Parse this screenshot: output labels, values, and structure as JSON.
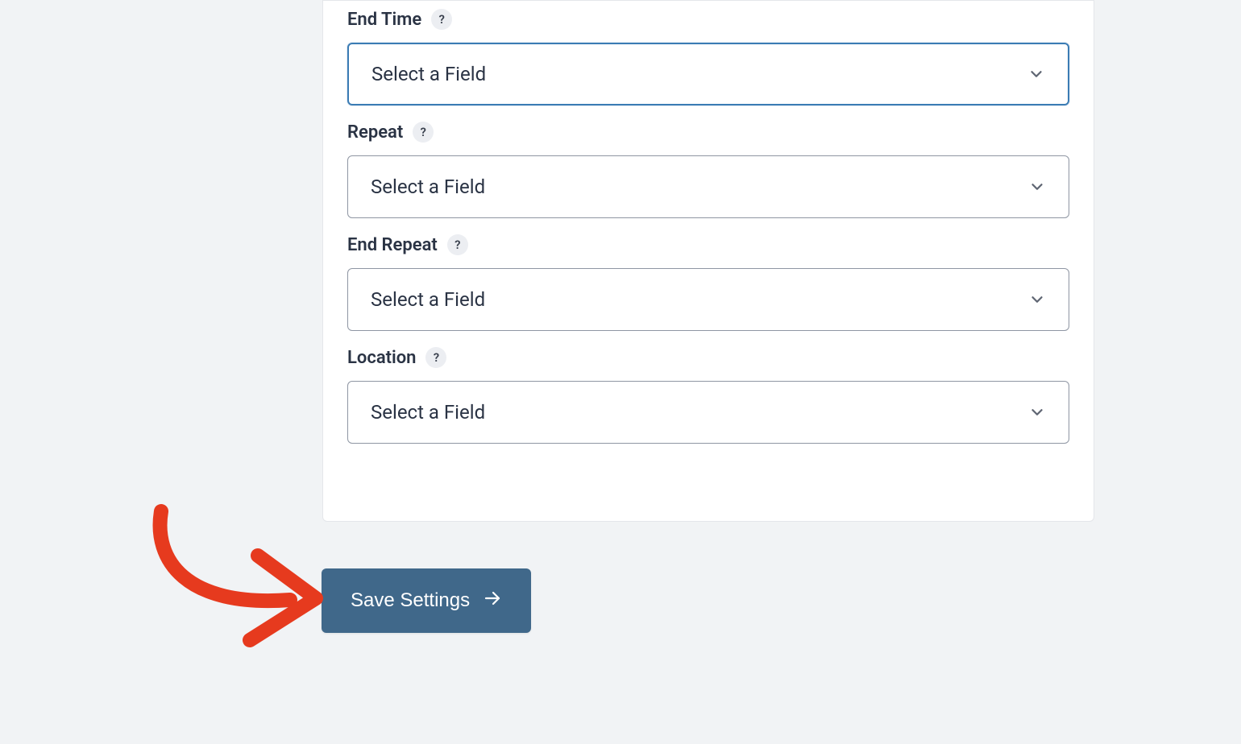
{
  "fields": [
    {
      "label": "End Time",
      "selectText": "Select a Field",
      "focused": true
    },
    {
      "label": "Repeat",
      "selectText": "Select a Field",
      "focused": false
    },
    {
      "label": "End Repeat",
      "selectText": "Select a Field",
      "focused": false
    },
    {
      "label": "Location",
      "selectText": "Select a Field",
      "focused": false
    }
  ],
  "helpBadge": "?",
  "saveButton": {
    "label": "Save Settings"
  }
}
